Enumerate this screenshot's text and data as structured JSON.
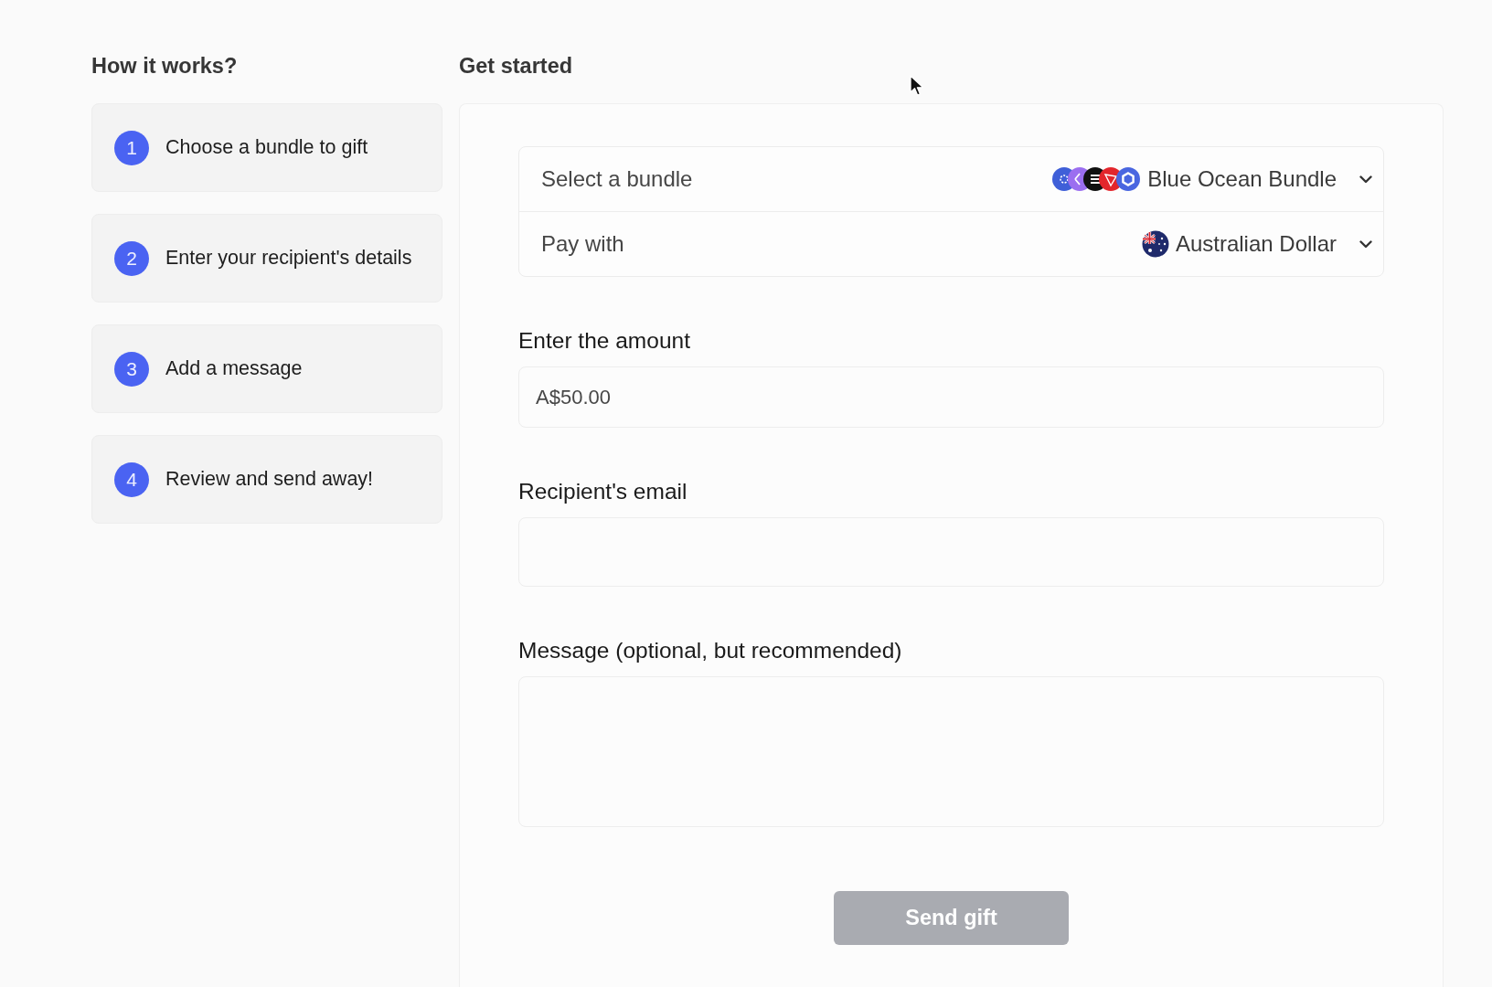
{
  "sidebar": {
    "title": "How it works?",
    "steps": [
      {
        "number": "1",
        "label": "Choose a bundle to gift"
      },
      {
        "number": "2",
        "label": "Enter your recipient's details"
      },
      {
        "number": "3",
        "label": "Add a message"
      },
      {
        "number": "4",
        "label": "Review and send away!"
      }
    ]
  },
  "form": {
    "title": "Get started",
    "selectors": [
      {
        "kind": "bundle",
        "label": "Select a bundle",
        "value": "Blue Ocean Bundle"
      },
      {
        "kind": "currency",
        "label": "Pay with",
        "value": "Australian Dollar"
      }
    ],
    "fields": [
      {
        "kind": "input",
        "label": "Enter the amount",
        "value": "A$50.00"
      },
      {
        "kind": "input",
        "label": "Recipient's email"
      },
      {
        "kind": "textarea",
        "label": "Message (optional, but recommended)"
      }
    ],
    "submit": {
      "label": "Send gift",
      "disabled": true
    }
  }
}
